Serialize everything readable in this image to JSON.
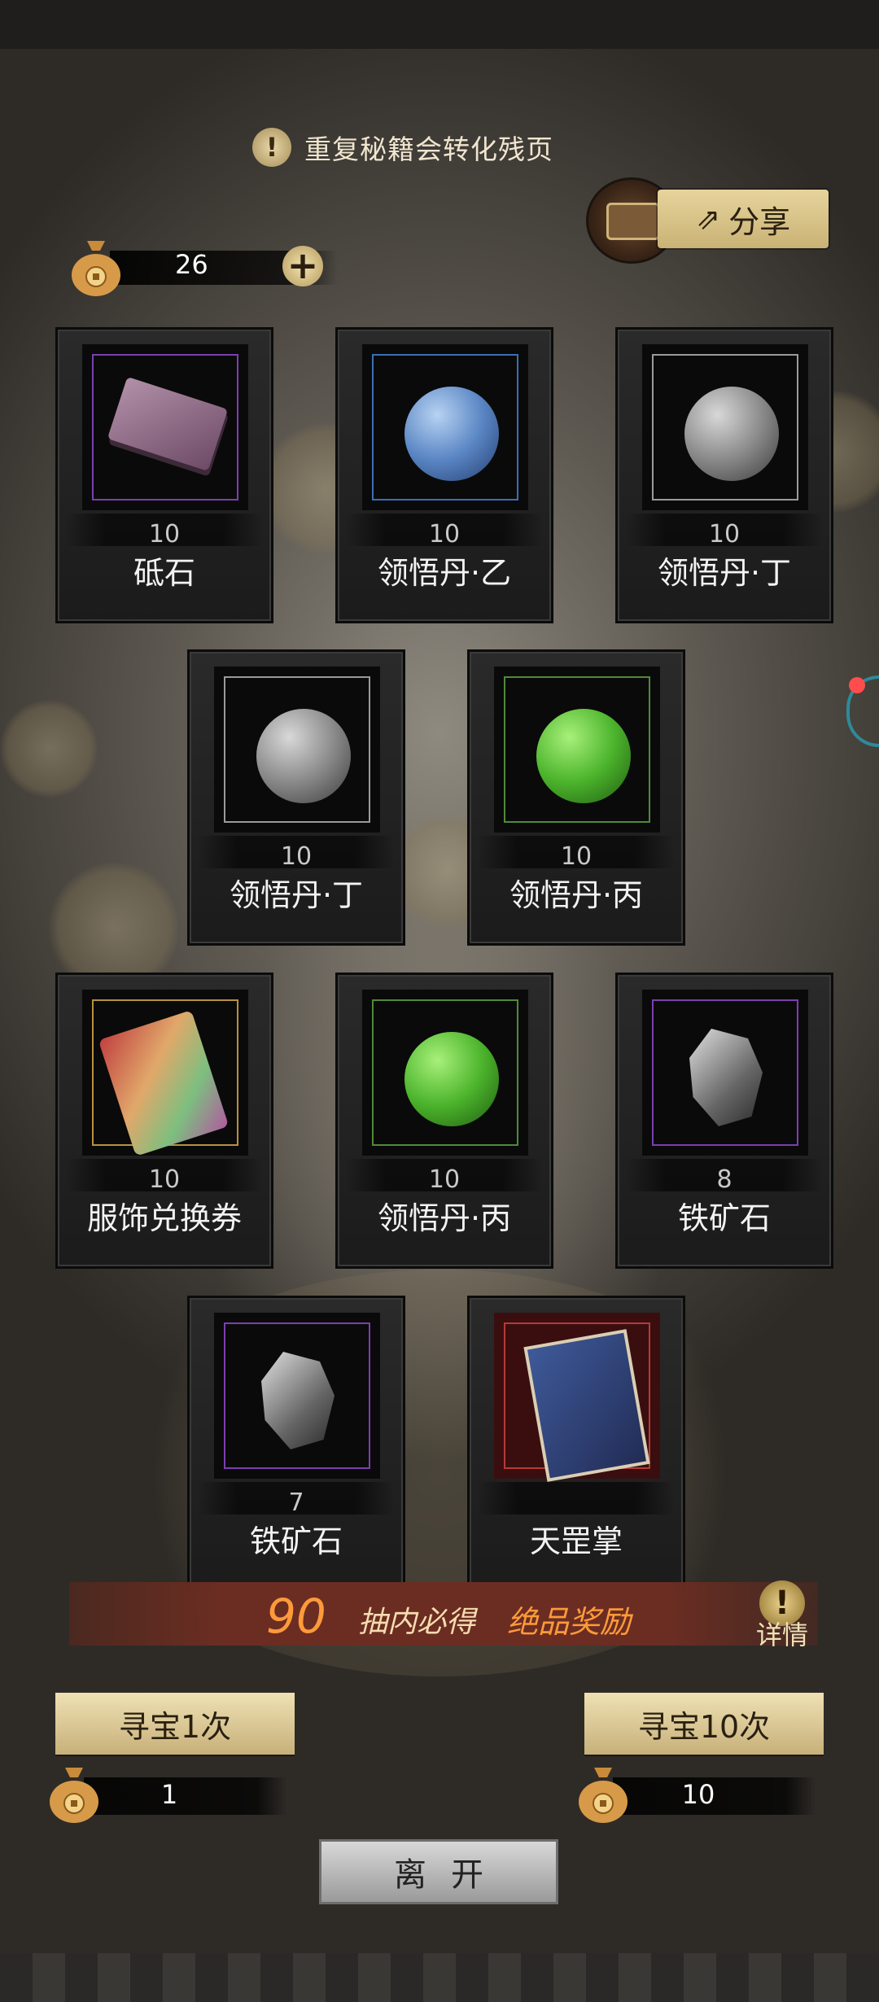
{
  "notice": {
    "text": "重复秘籍会转化残页"
  },
  "share": {
    "label": "分享"
  },
  "currency": {
    "amount": "26"
  },
  "items": [
    {
      "qty": "10",
      "name": "砥石",
      "rarity_color": "#7a3fb0",
      "art": "whetstone"
    },
    {
      "qty": "10",
      "name": "领悟丹·乙",
      "rarity_color": "#3b6fb5",
      "art": "blue-orb"
    },
    {
      "qty": "10",
      "name": "领悟丹·丁",
      "rarity_color": "#9a9a9a",
      "art": "grey-orb"
    },
    {
      "qty": "10",
      "name": "领悟丹·丁",
      "rarity_color": "#9a9a9a",
      "art": "grey-orb"
    },
    {
      "qty": "10",
      "name": "领悟丹·丙",
      "rarity_color": "#4f8a3a",
      "art": "green-orb"
    },
    {
      "qty": "10",
      "name": "服饰兑换券",
      "rarity_color": "#b89040",
      "art": "costume-ticket"
    },
    {
      "qty": "10",
      "name": "领悟丹·丙",
      "rarity_color": "#4f8a3a",
      "art": "green-orb"
    },
    {
      "qty": "8",
      "name": "铁矿石",
      "rarity_color": "#7a3fb0",
      "art": "iron-ore"
    },
    {
      "qty": "7",
      "name": "铁矿石",
      "rarity_color": "#7a3fb0",
      "art": "iron-ore"
    },
    {
      "qty": "",
      "name": "天罡掌",
      "rarity_color": "#b53a3a",
      "art": "manual-book"
    }
  ],
  "banner": {
    "count": "90",
    "text1": "抽内必得",
    "text2": "绝品奖励",
    "detail_label": "详情"
  },
  "draw_once": {
    "label": "寻宝1次",
    "cost": "1"
  },
  "draw_ten": {
    "label": "寻宝10次",
    "cost": "10"
  },
  "leave": {
    "label": "离开"
  }
}
